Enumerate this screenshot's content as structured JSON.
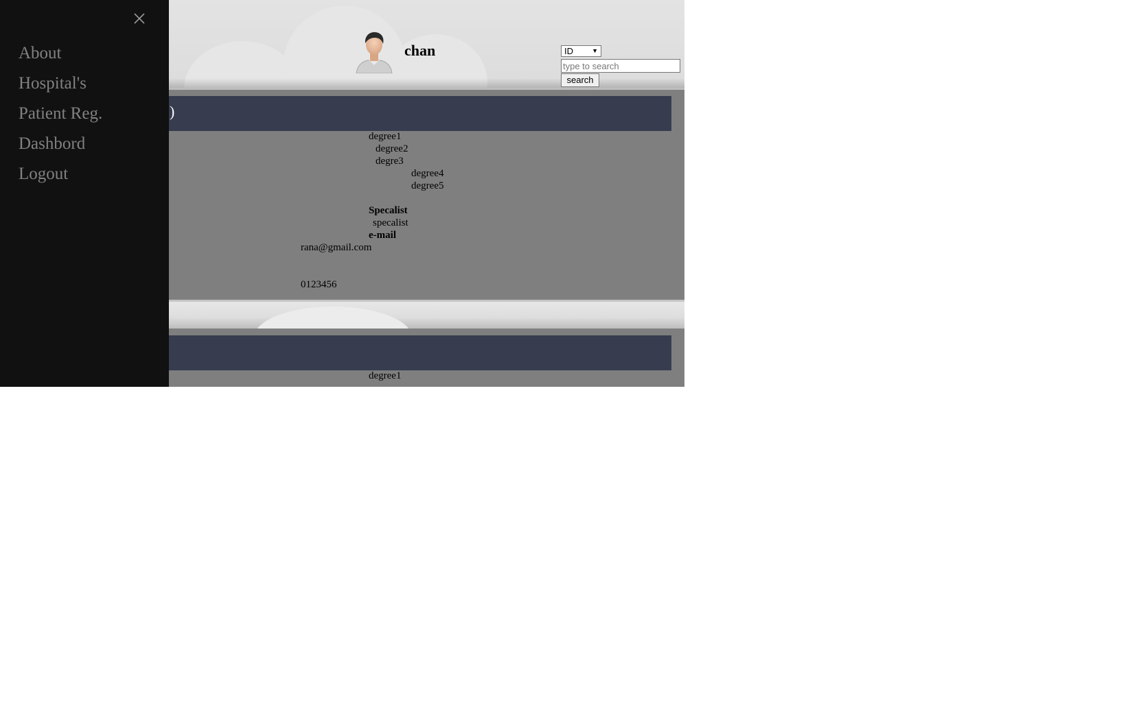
{
  "user": {
    "name": "chan",
    "avatar_icon": "user-avatar-icon"
  },
  "search": {
    "type_selected": "ID",
    "placeholder": "type to search",
    "button_label": "search"
  },
  "sidebar": {
    "close_icon": "close-icon",
    "items": [
      {
        "label": "About"
      },
      {
        "label": "Hospital's"
      },
      {
        "label": "Patient Reg."
      },
      {
        "label": "Dashbord"
      },
      {
        "label": "Logout"
      }
    ]
  },
  "doctors": [
    {
      "title_fragment": ")",
      "degrees": [
        "degree1",
        "degree2",
        "degre3",
        "degree4",
        "degree5"
      ],
      "specialist_heading": "Specalist",
      "specialist_value": "specalist",
      "email_heading": "e-mail",
      "email_value": "rana@gmail.com",
      "phone_value": "0123456"
    },
    {
      "title_fragment": "",
      "degrees": [
        "degree1"
      ]
    }
  ],
  "colors": {
    "sidebar_bg": "#111111",
    "sidebar_text": "#818181",
    "card_bar": "#373d4f",
    "content_bg": "#7f7f7f",
    "header_bg": "#e0e0e0"
  }
}
